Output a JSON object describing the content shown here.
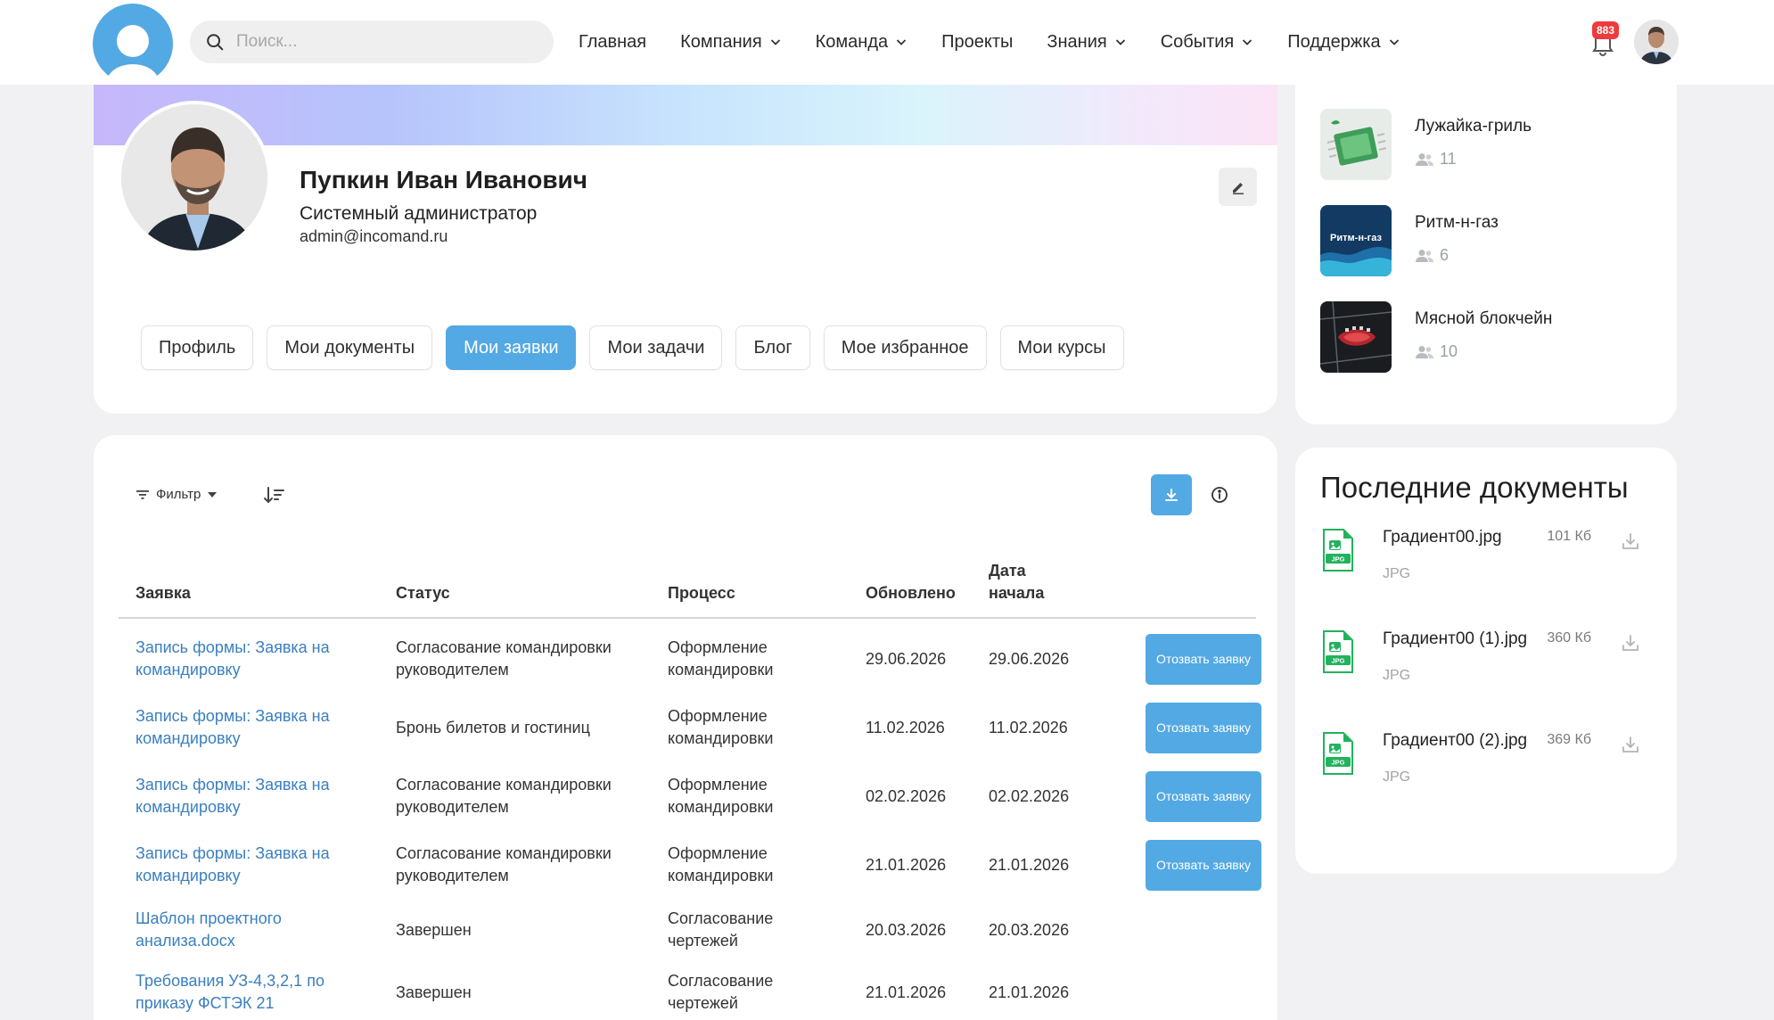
{
  "header": {
    "search_placeholder": "Поиск...",
    "nav": [
      {
        "label": "Главная",
        "dropdown": false
      },
      {
        "label": "Компания",
        "dropdown": true
      },
      {
        "label": "Команда",
        "dropdown": true
      },
      {
        "label": "Проекты",
        "dropdown": false
      },
      {
        "label": "Знания",
        "dropdown": true
      },
      {
        "label": "События",
        "dropdown": true
      },
      {
        "label": "Поддержка",
        "dropdown": true
      }
    ],
    "notifications_count": "883"
  },
  "profile": {
    "name": "Пупкин Иван Иванович",
    "role": "Системный администратор",
    "email": "admin@incomand.ru",
    "tabs": [
      "Профиль",
      "Мои документы",
      "Мои заявки",
      "Мои задачи",
      "Блог",
      "Мое избранное",
      "Мои курсы"
    ],
    "active_tab": "Мои заявки"
  },
  "requests": {
    "filter_label": "Фильтр",
    "columns": {
      "request": "Заявка",
      "status": "Статус",
      "process": "Процесс",
      "updated": "Обновлено",
      "start_date": "Дата начала"
    },
    "revoke_label": "Отозвать заявку",
    "rows": [
      {
        "request": "Запись формы: Заявка на командировку",
        "status": "Согласование командировки руководителем",
        "process": "Оформление командировки",
        "updated": "29.06.2026",
        "start": "29.06.2026",
        "revocable": true
      },
      {
        "request": "Запись формы: Заявка на командировку",
        "status": "Бронь билетов и гостиниц",
        "process": "Оформление командировки",
        "updated": "11.02.2026",
        "start": "11.02.2026",
        "revocable": true
      },
      {
        "request": "Запись формы: Заявка на командировку",
        "status": "Согласование командировки руководителем",
        "process": "Оформление командировки",
        "updated": "02.02.2026",
        "start": "02.02.2026",
        "revocable": true
      },
      {
        "request": "Запись формы: Заявка на командировку",
        "status": "Согласование командировки руководителем",
        "process": "Оформление командировки",
        "updated": "21.01.2026",
        "start": "21.01.2026",
        "revocable": true
      },
      {
        "request": "Шаблон проектного анализа.docx",
        "status": "Завершен",
        "process": "Согласование чертежей",
        "updated": "20.03.2026",
        "start": "20.03.2026",
        "revocable": false
      },
      {
        "request": "Требования УЗ-4,3,2,1 по приказу ФСТЭК 21",
        "status": "Завершен",
        "process": "Согласование чертежей",
        "updated": "21.01.2026",
        "start": "21.01.2026",
        "revocable": false
      }
    ]
  },
  "groups": [
    {
      "name": "Лужайка-гриль",
      "members": "11",
      "icon": "chip-icon"
    },
    {
      "name": "Ритм-н-газ",
      "members": "6",
      "icon": "music-logo",
      "logo_text": "Ритм-н-газ"
    },
    {
      "name": "Мясной блокчейн",
      "members": "10",
      "icon": "circuit-icon"
    }
  ],
  "documents": {
    "title": "Последние документы",
    "items": [
      {
        "name": "Градиент00.jpg",
        "size": "101 Кб",
        "ext": "JPG",
        "badge": "JPG"
      },
      {
        "name": "Градиент00 (1).jpg",
        "size": "360 Кб",
        "ext": "JPG",
        "badge": "JPG"
      },
      {
        "name": "Градиент00 (2).jpg",
        "size": "369 Кб",
        "ext": "JPG",
        "badge": "JPG"
      }
    ]
  },
  "colors": {
    "accent": "#53a9e3",
    "link": "#3a7fc0",
    "badge": "#ee3b3b",
    "doc_icon": "#22b25d"
  }
}
